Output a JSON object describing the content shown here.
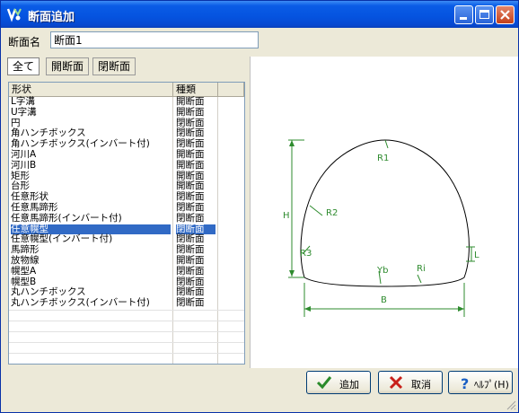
{
  "window": {
    "title": "断面追加"
  },
  "name_field": {
    "label": "断面名",
    "value": "断面1"
  },
  "tabs": [
    {
      "label": "全て",
      "active": true
    },
    {
      "label": "開断面",
      "active": false
    },
    {
      "label": "閉断面",
      "active": false
    }
  ],
  "list": {
    "columns": [
      "形状",
      "種類"
    ],
    "selected_index": 12,
    "rows": [
      {
        "shape": "L字溝",
        "type": "開断面"
      },
      {
        "shape": "U字溝",
        "type": "開断面"
      },
      {
        "shape": "円",
        "type": "閉断面"
      },
      {
        "shape": "角ハンチボックス",
        "type": "閉断面"
      },
      {
        "shape": "角ハンチボックス(インバート付)",
        "type": "閉断面"
      },
      {
        "shape": "河川A",
        "type": "開断面"
      },
      {
        "shape": "河川B",
        "type": "開断面"
      },
      {
        "shape": "矩形",
        "type": "開断面"
      },
      {
        "shape": "台形",
        "type": "開断面"
      },
      {
        "shape": "任意形状",
        "type": "閉断面"
      },
      {
        "shape": "任意馬蹄形",
        "type": "閉断面"
      },
      {
        "shape": "任意馬蹄形(インバート付)",
        "type": "閉断面"
      },
      {
        "shape": "任意幌型",
        "type": "閉断面"
      },
      {
        "shape": "任意幌型(インバート付)",
        "type": "閉断面"
      },
      {
        "shape": "馬蹄形",
        "type": "閉断面"
      },
      {
        "shape": "放物線",
        "type": "開断面"
      },
      {
        "shape": "幌型A",
        "type": "閉断面"
      },
      {
        "shape": "幌型B",
        "type": "閉断面"
      },
      {
        "shape": "丸ハンチボックス",
        "type": "閉断面"
      },
      {
        "shape": "丸ハンチボックス(インバート付)",
        "type": "閉断面"
      }
    ]
  },
  "preview": {
    "labels": {
      "r1": "R1",
      "r2": "R2",
      "r3": "R3",
      "h": "H",
      "yb": "Yb",
      "ri": "Ri",
      "b": "B",
      "l": "L"
    },
    "line_color": "#2e8b2e"
  },
  "buttons": {
    "add": "追加",
    "cancel": "取消",
    "help": "ﾍﾙﾌﾟ(H)"
  }
}
